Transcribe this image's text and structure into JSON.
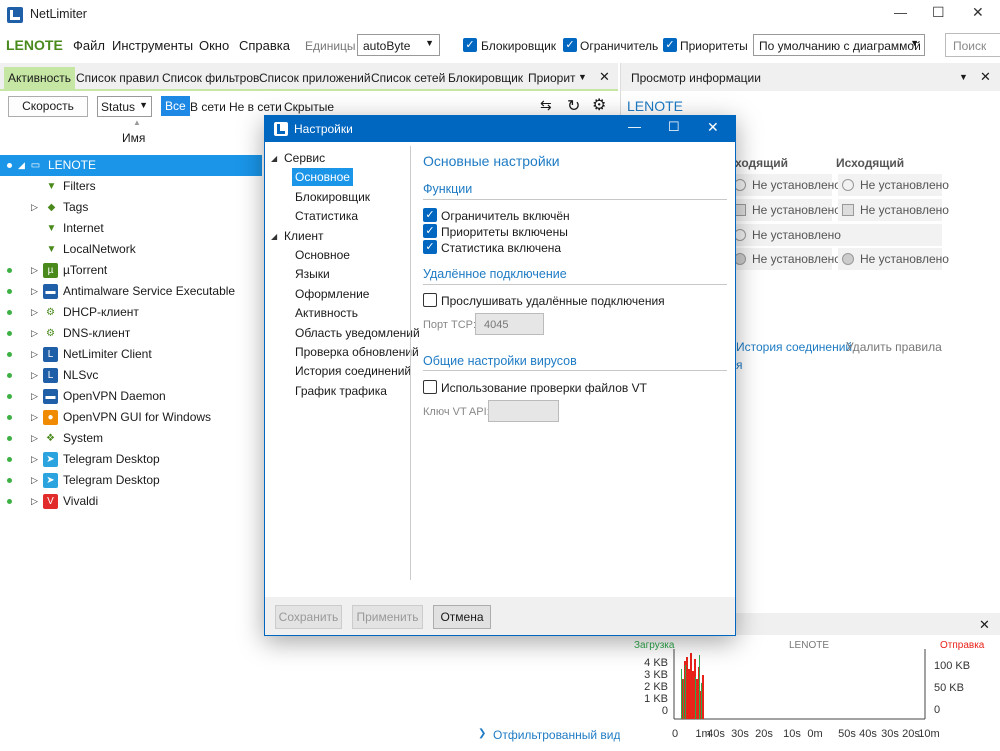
{
  "window": {
    "title": "NetLimiter",
    "min": "—",
    "max": "☐",
    "close": "✕"
  },
  "menu": {
    "brand": "LENOTE",
    "items": [
      "Файл",
      "Инструменты",
      "Окно",
      "Справка"
    ],
    "units_label": "Единицы",
    "units_value": "autoByte",
    "checks": [
      "Блокировщик",
      "Ограничитель",
      "Приоритеты"
    ],
    "profile_value": "По умолчанию с диаграммой",
    "search_label": "Поиск"
  },
  "tabs": [
    "Активность",
    "Список правил",
    "Список фильтров",
    "Список приложений",
    "Список сетей",
    "Блокировщик",
    "Приорит"
  ],
  "toolbar": {
    "speed": "Скорость",
    "status": "Status",
    "filters": [
      "Все",
      "В сети",
      "Не в сети",
      "Скрытые"
    ]
  },
  "tree": {
    "column": "Имя",
    "rows": [
      {
        "label": "LENOTE",
        "icon": "monitor-icon",
        "dot": true,
        "arrow": "◢",
        "indent": 0
      },
      {
        "label": "Filters",
        "icon": "filter-icon",
        "dot": false,
        "arrow": "",
        "indent": 1
      },
      {
        "label": "Tags",
        "icon": "tag-icon",
        "dot": false,
        "arrow": "▷",
        "indent": 1
      },
      {
        "label": "Internet",
        "icon": "filter-icon",
        "dot": false,
        "arrow": "",
        "indent": 1
      },
      {
        "label": "LocalNetwork",
        "icon": "filter-icon",
        "dot": false,
        "arrow": "",
        "indent": 1
      },
      {
        "label": "µTorrent",
        "icon": "utorrent-icon",
        "dot": true,
        "arrow": "▷",
        "indent": 0
      },
      {
        "label": "Antimalware Service Executable",
        "icon": "app-window-icon",
        "dot": true,
        "arrow": "▷",
        "indent": 0
      },
      {
        "label": "DHCP-клиент",
        "icon": "gear-icon",
        "dot": true,
        "arrow": "▷",
        "indent": 0
      },
      {
        "label": "DNS-клиент",
        "icon": "gear-icon",
        "dot": true,
        "arrow": "▷",
        "indent": 0
      },
      {
        "label": "NetLimiter Client",
        "icon": "netlimiter-icon",
        "dot": true,
        "arrow": "▷",
        "indent": 0
      },
      {
        "label": "NLSvc",
        "icon": "netlimiter-icon",
        "dot": true,
        "arrow": "▷",
        "indent": 0
      },
      {
        "label": "OpenVPN Daemon",
        "icon": "app-window-icon",
        "dot": true,
        "arrow": "▷",
        "indent": 0
      },
      {
        "label": "OpenVPN GUI for Windows",
        "icon": "openvpn-icon",
        "dot": true,
        "arrow": "▷",
        "indent": 0
      },
      {
        "label": "System",
        "icon": "system-icon",
        "dot": true,
        "arrow": "▷",
        "indent": 0
      },
      {
        "label": "Telegram Desktop",
        "icon": "telegram-icon",
        "dot": true,
        "arrow": "▷",
        "indent": 0
      },
      {
        "label": "Telegram Desktop",
        "icon": "telegram-icon",
        "dot": true,
        "arrow": "▷",
        "indent": 0
      },
      {
        "label": "Vivaldi",
        "icon": "vivaldi-icon",
        "dot": true,
        "arrow": "▷",
        "indent": 0
      }
    ],
    "footer_link": "Отфильтрованный вид"
  },
  "right_panel": {
    "title": "Просмотр информации",
    "host": "LENOTE",
    "col_in": "ходящий",
    "col_out": "Исходящий",
    "cells": [
      "Не установлено",
      "Не установлено",
      "Не установлено",
      "Не установлено",
      "Не установлено",
      "Не установлено",
      "Не установлено"
    ],
    "link_history": "История соединений",
    "link_delete": "Удалить правила",
    "link_extra": "я"
  },
  "graph": {
    "label_in": "Загрузка",
    "label_host": "LENOTE",
    "label_out": "Отправка",
    "left_ticks": [
      "4 KB",
      "3 KB",
      "2 KB",
      "1 KB",
      "0"
    ],
    "right_ticks": [
      "100 KB",
      "50 KB",
      "0"
    ],
    "x_ticks": [
      "0",
      "1m",
      "40s",
      "30s",
      "20s",
      "10s",
      "0m",
      "50s",
      "40s",
      "30s",
      "20s",
      "10m"
    ],
    "color_in": "#2da84a",
    "color_out": "#e8231a"
  },
  "dialog": {
    "title": "Настройки",
    "nav": [
      {
        "label": "Сервис",
        "group": true
      },
      {
        "label": "Основное",
        "group": false,
        "selected": true
      },
      {
        "label": "Блокировщик",
        "group": false
      },
      {
        "label": "Статистика",
        "group": false
      },
      {
        "label": "Клиент",
        "group": true
      },
      {
        "label": "Основное",
        "group": false
      },
      {
        "label": "Языки",
        "group": false
      },
      {
        "label": "Оформление",
        "group": false
      },
      {
        "label": "Активность",
        "group": false
      },
      {
        "label": "Область уведомлений",
        "group": false
      },
      {
        "label": "Проверка обновлений",
        "group": false
      },
      {
        "label": "История соединений",
        "group": false
      },
      {
        "label": "График трафика",
        "group": false
      }
    ],
    "heading": "Основные настройки",
    "section_functions": "Функции",
    "functions": [
      {
        "label": "Ограничитель включён",
        "checked": true
      },
      {
        "label": "Приоритеты включены",
        "checked": true
      },
      {
        "label": "Статистика включена",
        "checked": true
      }
    ],
    "section_remote": "Удалённое подключение",
    "remote_listen": "Прослушивать удалённые подключения",
    "tcp_label": "Порт TCP:",
    "tcp_value": "4045",
    "section_virus": "Общие настройки вирусов",
    "vt_check": "Использование проверки файлов VT",
    "vt_key_label": "Ключ VT API:",
    "vt_key_value": "",
    "btn_save": "Сохранить",
    "btn_apply": "Применить",
    "btn_cancel": "Отмена"
  }
}
